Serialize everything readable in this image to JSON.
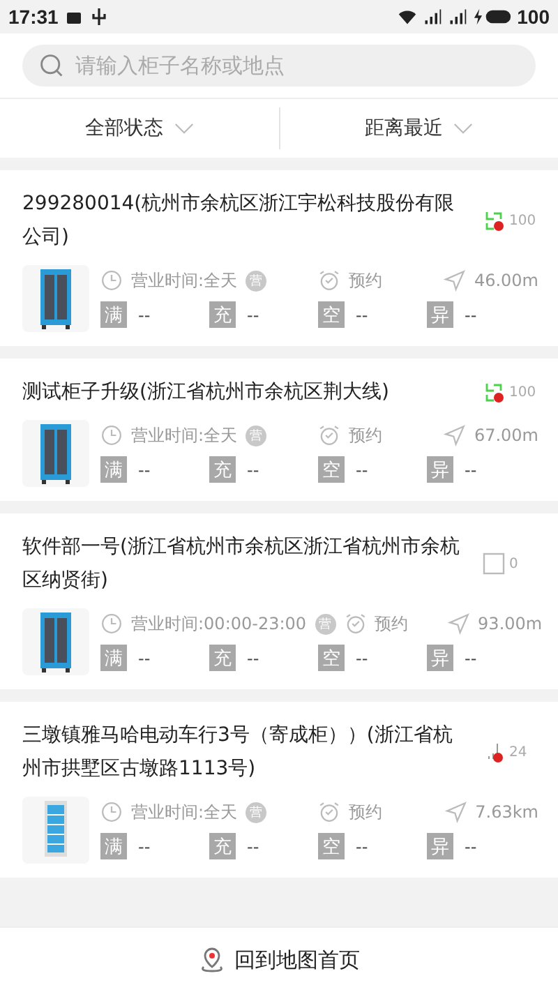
{
  "status_bar": {
    "time": "17:31",
    "battery": "100"
  },
  "search": {
    "placeholder": "请输入柜子名称或地点"
  },
  "filters": [
    {
      "label": "全部状态"
    },
    {
      "label": "距离最近"
    }
  ],
  "cabinets": [
    {
      "name": "299280014(杭州市余杭区浙江宇松科技股份有限公司)",
      "status": {
        "kind": "offline",
        "count": "100"
      },
      "image": {
        "kind": "charging"
      },
      "hours": "营业时间:全天",
      "hours_badge": "营",
      "reserve": "预约",
      "distance": "46.00m",
      "stats": [
        {
          "tag": "满",
          "value": "--"
        },
        {
          "tag": "充",
          "value": "--"
        },
        {
          "tag": "空",
          "value": "--"
        },
        {
          "tag": "异",
          "value": "--"
        }
      ]
    },
    {
      "name": "测试柜子升级(浙江省杭州市余杭区荆大线)",
      "status": {
        "kind": "offline",
        "count": "100"
      },
      "image": {
        "kind": "charging"
      },
      "hours": "营业时间:全天",
      "hours_badge": "营",
      "reserve": "预约",
      "distance": "67.00m",
      "stats": [
        {
          "tag": "满",
          "value": "--"
        },
        {
          "tag": "充",
          "value": "--"
        },
        {
          "tag": "空",
          "value": "--"
        },
        {
          "tag": "异",
          "value": "--"
        }
      ]
    },
    {
      "name": "软件部一号(浙江省杭州市余杭区浙江省杭州市余杭区纳贤街)",
      "status": {
        "kind": "box",
        "count": "0"
      },
      "image": {
        "kind": "charging"
      },
      "hours": "营业时间:00:00-23:00",
      "hours_badge": "营",
      "reserve": "预约",
      "distance": "93.00m",
      "stats": [
        {
          "tag": "满",
          "value": "--"
        },
        {
          "tag": "充",
          "value": "--"
        },
        {
          "tag": "空",
          "value": "--"
        },
        {
          "tag": "异",
          "value": "--"
        }
      ]
    },
    {
      "name": "三墩镇雅马哈电动车行3号（寄成柜））(浙江省杭州市拱墅区古墩路1113号)",
      "status": {
        "kind": "signal",
        "count": "24"
      },
      "image": {
        "kind": "locker"
      },
      "hours": "营业时间:全天",
      "hours_badge": "营",
      "reserve": "预约",
      "distance": "7.63km",
      "stats": [
        {
          "tag": "满",
          "value": "--"
        },
        {
          "tag": "充",
          "value": "--"
        },
        {
          "tag": "空",
          "value": "--"
        },
        {
          "tag": "异",
          "value": "--"
        }
      ]
    }
  ],
  "bottom": {
    "label": "回到地图首页"
  }
}
